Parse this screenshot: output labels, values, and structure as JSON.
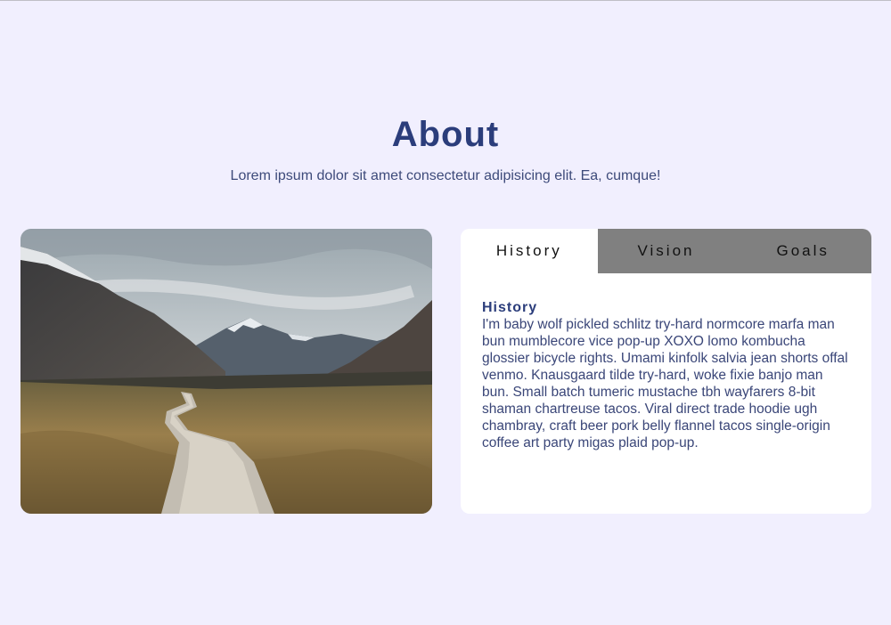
{
  "header": {
    "title": "About",
    "subtitle": "Lorem ipsum dolor sit amet consectetur adipisicing elit. Ea, cumque!"
  },
  "tabs": [
    {
      "label": "History",
      "active": true
    },
    {
      "label": "Vision",
      "active": false
    },
    {
      "label": "Goals",
      "active": false
    }
  ],
  "content": {
    "title": "History",
    "text": "I'm baby wolf pickled schlitz try-hard normcore marfa man bun mumblecore vice pop-up XOXO lomo kombucha glossier bicycle rights. Umami kinfolk salvia jean shorts offal venmo. Knausgaard tilde try-hard, woke fixie banjo man bun. Small batch tumeric mustache tbh wayfarers 8-bit shaman chartreuse tacos. Viral direct trade hoodie ugh chambray, craft beer pork belly flannel tacos single-origin coffee art party migas plaid pop-up."
  },
  "colors": {
    "background": "#f1effe",
    "accent": "#2b3d7b",
    "tab_inactive": "#808080",
    "tab_active": "#ffffff"
  },
  "image": {
    "icon": "mountain-boardwalk-photo"
  }
}
